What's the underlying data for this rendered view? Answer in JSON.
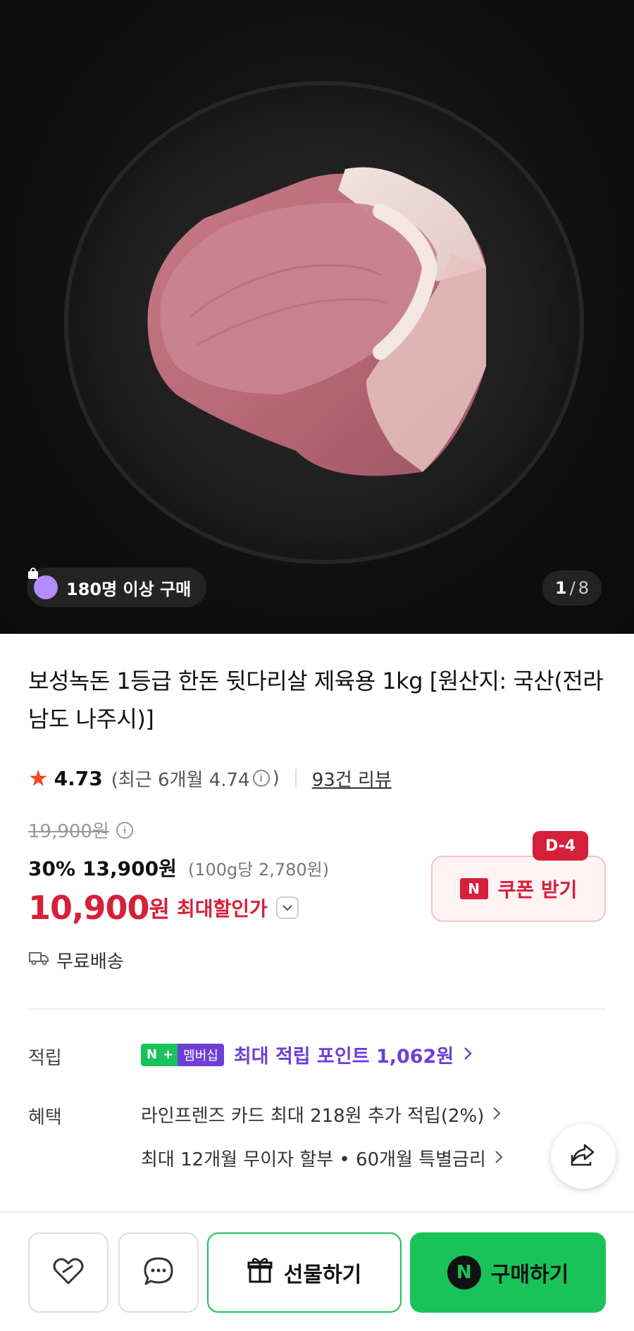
{
  "hero": {
    "buyers_badge": "180명 이상 구매",
    "page_current": "1",
    "page_total": "8"
  },
  "product": {
    "title": "보성녹돈 1등급 한돈 뒷다리살 제육용 1kg [원산지: 국산(전라남도 나주시)]",
    "rating": "4.73",
    "rating_recent": "(최근 6개월 4.74",
    "rating_recent_close": ")",
    "review_count": "93건 리뷰",
    "original_price": "19,900원",
    "discount_rate": "30%",
    "sale_price": "13,900원",
    "unit_price": "(100g당 2,780원)",
    "max_discount_price": "10,900",
    "max_discount_won": "원",
    "max_discount_label": "최대할인가",
    "coupon_label": "쿠폰 받기",
    "coupon_dday": "D-4",
    "shipping": "무료배송"
  },
  "points": {
    "label": "적립",
    "badge_n": "N",
    "badge_plus": "+",
    "badge_membership": "멤버십",
    "text": "최대 적립 포인트 1,062원"
  },
  "benefits": {
    "label": "혜택",
    "items": [
      "라인프렌즈 카드 최대 218원 추가 적립(2%)",
      "최대 12개월 무이자 할부 • 60개월 특별금리"
    ]
  },
  "bottom_bar": {
    "gift_label": "선물하기",
    "buy_label": "구매하기",
    "buy_badge": "N"
  },
  "colors": {
    "accent_red": "#d61f3a",
    "naver_green": "#19c35a",
    "membership_purple": "#6e3fd6"
  }
}
